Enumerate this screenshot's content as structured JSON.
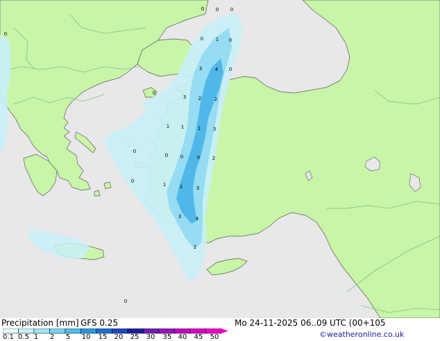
{
  "map": {
    "colors": {
      "sea": "#e8e8e8",
      "land": "#c8f5a8",
      "coast": "#5a5a5a",
      "border": "#7fbf7f",
      "precip_light": "#c8f0f8",
      "precip_mid": "#96dcf2",
      "precip_heavy": "#50b8e8"
    },
    "point_labels": [
      "0",
      "0",
      "0",
      "0",
      "0",
      "1",
      "0",
      "3",
      "4",
      "0",
      "0",
      "3",
      "2",
      "2",
      "1",
      "1",
      "1",
      "3",
      "0",
      "0",
      "0",
      "2",
      "0",
      "0",
      "1",
      "2",
      "3",
      "3",
      "4",
      "2",
      "0",
      "0"
    ]
  },
  "footer": {
    "title": "Precipitation [mm]",
    "model": "GFS 0.25",
    "datetime": "Mo 24-11-2025 06..09 UTC (00+105",
    "credit": "©weatheronline.co.uk"
  },
  "legend": {
    "labels": [
      "0.1",
      "0.5",
      "1",
      "2",
      "5",
      "10",
      "15",
      "20",
      "25",
      "30",
      "35",
      "40",
      "45",
      "50"
    ],
    "colors": [
      "#e6fafc",
      "#c8f0fa",
      "#a0e4f6",
      "#78d2f0",
      "#50bce8",
      "#2896dc",
      "#1e6ed2",
      "#1e46be",
      "#1e1ea0",
      "#6e1eb4",
      "#9614be",
      "#be0ac8",
      "#dc00c8",
      "#f000c8"
    ]
  }
}
